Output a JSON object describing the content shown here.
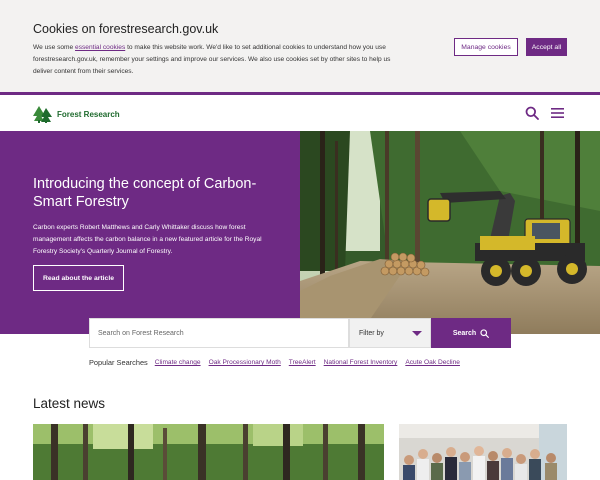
{
  "cookie": {
    "title": "Cookies on forestresearch.gov.uk",
    "text_before_link": "We use some ",
    "link_text": "essential cookies",
    "text_after_link": " to make this website work. We'd like to set additional cookies to understand how you use forestresearch.gov.uk, remember your settings and improve our services. We also use cookies set by other sites to help us deliver content from their services.",
    "manage_label": "Manage cookies",
    "accept_label": "Accept all"
  },
  "header": {
    "logo_text": "Forest Research",
    "icons": [
      "search-icon",
      "menu-icon"
    ]
  },
  "hero": {
    "title": "Introducing the concept of Carbon-Smart Forestry",
    "description": "Carbon experts Robert Matthews and Carly Whittaker discuss how forest management affects the carbon balance in a new featured article for the Royal Forestry Society's Quarterly Journal of Forestry.",
    "button_label": "Read about the article"
  },
  "search": {
    "placeholder": "Search on Forest Research",
    "filter_label": "Filter by",
    "button_label": "Search"
  },
  "popular": {
    "label": "Popular Searches",
    "items": [
      "Climate change",
      "Oak Processionary Moth",
      "TreeAlert",
      "National Forest Inventory",
      "Acute Oak Decline"
    ]
  },
  "news": {
    "heading": "Latest news"
  },
  "colors": {
    "brand_purple": "#6e2a84",
    "logo_green": "#1f6b2e",
    "banner_bg": "#f3f2f1"
  }
}
